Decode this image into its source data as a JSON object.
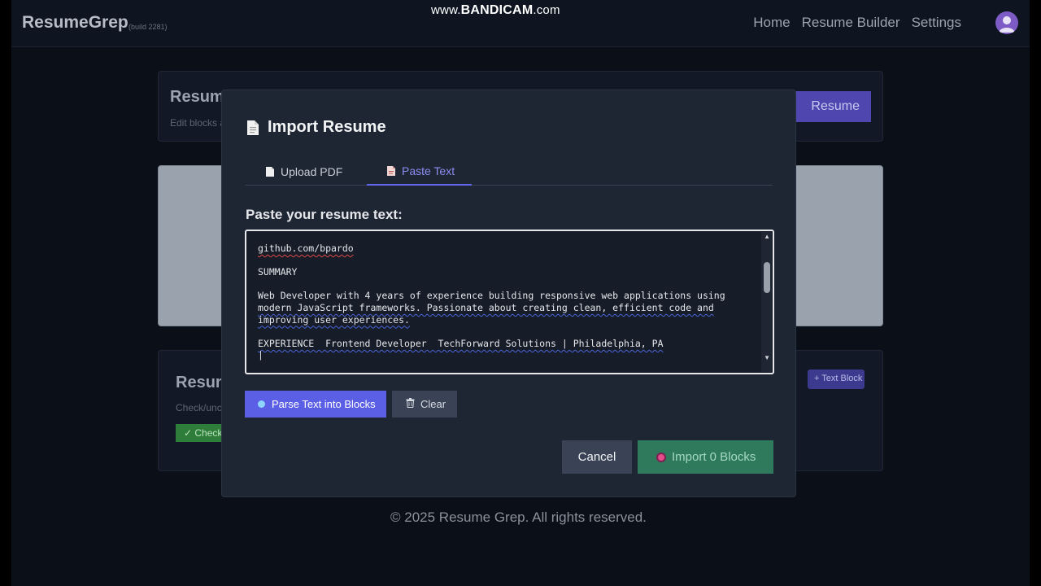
{
  "navbar": {
    "brand": "ResumeGrep",
    "build": "(build 2281)",
    "watermark": "www.BANDICAM.com",
    "links": [
      "Home",
      "Resume Builder",
      "Settings"
    ]
  },
  "background": {
    "card1_title": "Resume",
    "card1_sub": "Edit blocks and",
    "card1_button": "Resume",
    "card3_title": "Resume",
    "card3_sub": "Check/unche",
    "card3_check_button": "✓ Check Al",
    "card3_text_block_button": "+ Text Block",
    "footer": "© 2025 Resume Grep. All rights reserved."
  },
  "modal": {
    "title": "Import Resume",
    "tabs": [
      {
        "label": "Upload PDF",
        "active": false
      },
      {
        "label": "Paste Text",
        "active": true
      }
    ],
    "paste_label": "Paste your resume text:",
    "textarea_lines": [
      "github.com/bpardo",
      "",
      "SUMMARY",
      "",
      "Web Developer with 4 years of experience building responsive web applications using",
      "modern JavaScript frameworks. Passionate about creating clean, efficient code and",
      "improving user experiences.",
      "",
      "EXPERIENCE  Frontend Developer  TechForward Solutions | Philadelphia, PA",
      "|"
    ],
    "parse_button": "Parse Text into Blocks",
    "clear_button": "Clear",
    "cancel_button": "Cancel",
    "import_button": "Import 0 Blocks"
  },
  "colors": {
    "accent": "#6366f1",
    "import_green": "#2f7a5c",
    "modal_bg": "#1e2533"
  }
}
